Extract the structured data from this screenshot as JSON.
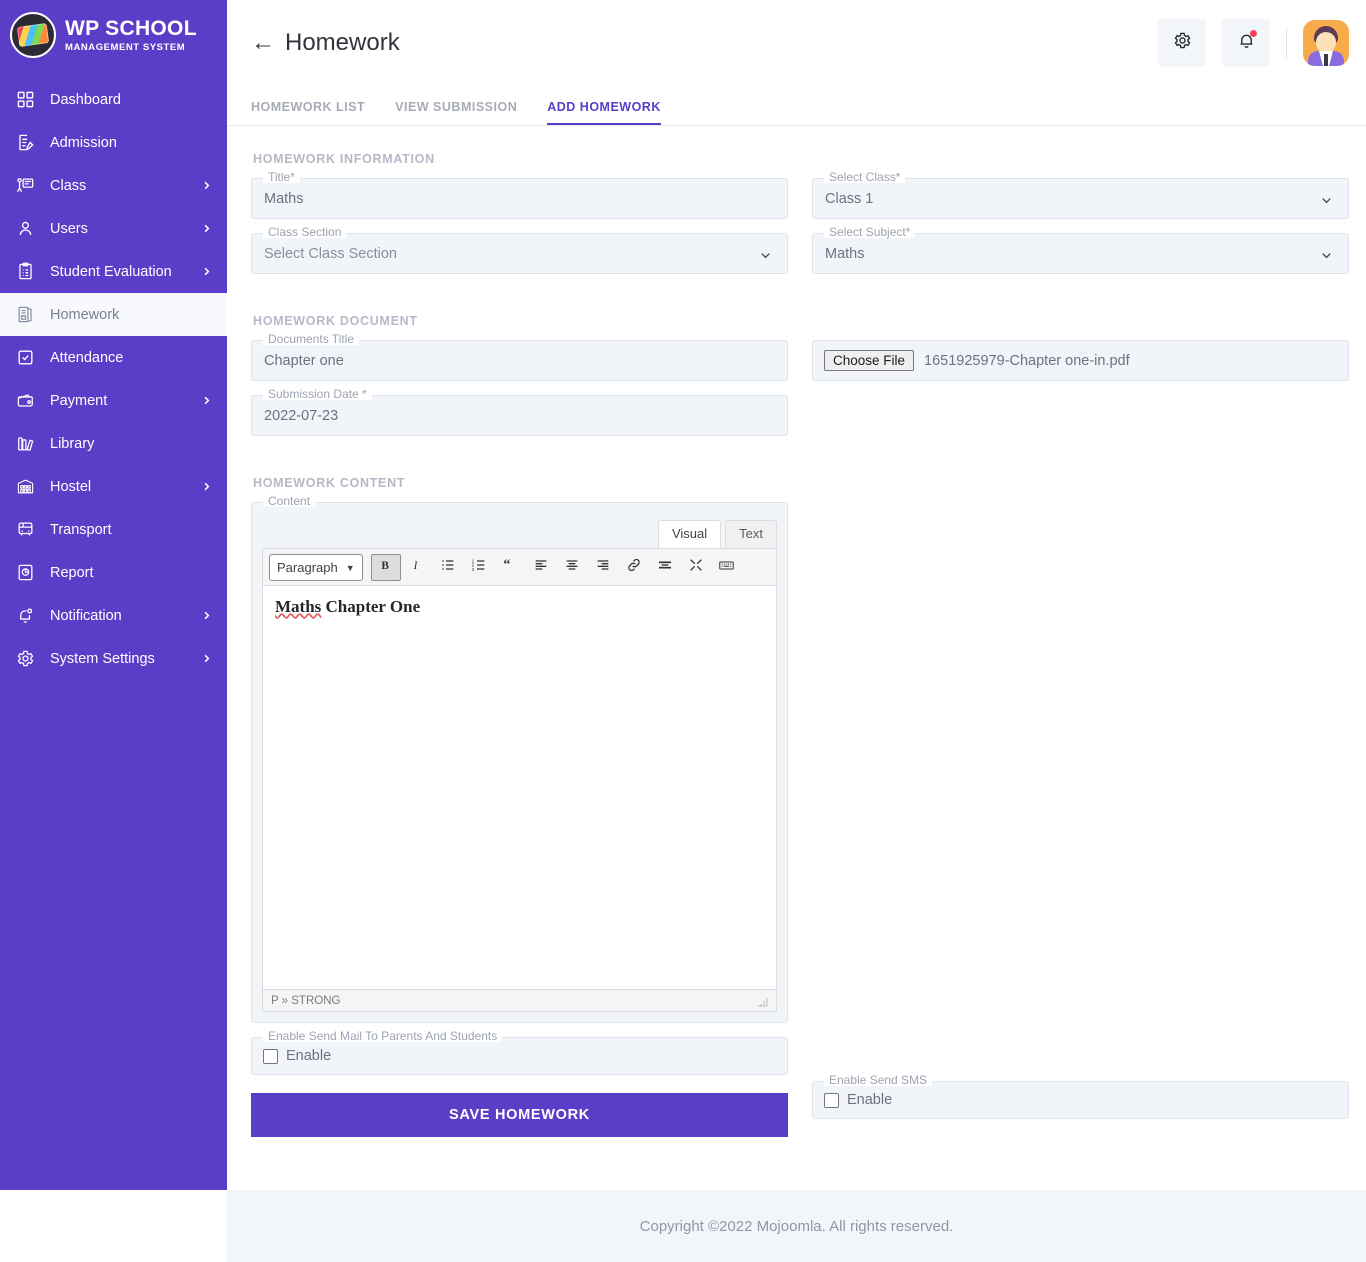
{
  "brand": {
    "title": "WP SCHOOL",
    "subtitle": "MANAGEMENT SYSTEM",
    "logo_icon": "graduation-cap-logo"
  },
  "colors": {
    "sidebar": "#5a3ec8",
    "accent": "#5a3ec8",
    "field_bg": "#f1f4f9",
    "field_border": "#dfe3ec",
    "footer_bg": "#f2f5fa",
    "notification_dot": "#f1435e"
  },
  "sidebar": {
    "items": [
      {
        "label": "Dashboard",
        "icon": "grid-icon",
        "expandable": false,
        "active": false
      },
      {
        "label": "Admission",
        "icon": "document-edit-icon",
        "expandable": false,
        "active": false
      },
      {
        "label": "Class",
        "icon": "teacher-board-icon",
        "expandable": true,
        "active": false
      },
      {
        "label": "Users",
        "icon": "user-icon",
        "expandable": true,
        "active": false
      },
      {
        "label": "Student Evaluation",
        "icon": "clipboard-list-icon",
        "expandable": true,
        "active": false
      },
      {
        "label": "Homework",
        "icon": "book-icon",
        "expandable": false,
        "active": true
      },
      {
        "label": "Attendance",
        "icon": "clipboard-check-icon",
        "expandable": false,
        "active": false
      },
      {
        "label": "Payment",
        "icon": "wallet-icon",
        "expandable": true,
        "active": false
      },
      {
        "label": "Library",
        "icon": "books-icon",
        "expandable": false,
        "active": false
      },
      {
        "label": "Hostel",
        "icon": "building-icon",
        "expandable": true,
        "active": false
      },
      {
        "label": "Transport",
        "icon": "bus-icon",
        "expandable": false,
        "active": false
      },
      {
        "label": "Report",
        "icon": "report-chart-icon",
        "expandable": false,
        "active": false
      },
      {
        "label": "Notification",
        "icon": "bell-pin-icon",
        "expandable": true,
        "active": false
      },
      {
        "label": "System Settings",
        "icon": "gear-icon",
        "expandable": true,
        "active": false
      }
    ]
  },
  "header": {
    "back_icon": "arrow-left-icon",
    "title": "Homework",
    "settings_icon": "gear-icon",
    "notification_icon": "bell-icon",
    "avatar_icon": "user-avatar"
  },
  "tabs": [
    {
      "label": "HOMEWORK LIST",
      "active": false
    },
    {
      "label": "VIEW SUBMISSION",
      "active": false
    },
    {
      "label": "ADD HOMEWORK",
      "active": true
    }
  ],
  "sections": {
    "information_title": "HOMEWORK INFORMATION",
    "document_title": "HOMEWORK DOCUMENT",
    "content_title": "HOMEWORK CONTENT"
  },
  "form": {
    "title": {
      "label": "Title*",
      "value": "Maths"
    },
    "select_class": {
      "label": "Select Class*",
      "value": "Class 1",
      "icon": "chevron-down-icon"
    },
    "class_section": {
      "label": "Class Section",
      "value": "Select Class Section",
      "icon": "chevron-down-icon"
    },
    "select_subject": {
      "label": "Select Subject*",
      "value": "Maths",
      "icon": "chevron-down-icon"
    },
    "documents_title": {
      "label": "Documents Title",
      "value": "Chapter one"
    },
    "submission_date": {
      "label": "Submission Date *",
      "value": "2022-07-23"
    },
    "file_upload": {
      "button_label": "Choose File",
      "file_name": "1651925979-Chapter one-in.pdf"
    },
    "enable_mail": {
      "label": "Enable Send Mail To Parents And Students",
      "checkbox_label": "Enable",
      "checked": false
    },
    "enable_sms": {
      "label": "Enable Send SMS",
      "checkbox_label": "Enable",
      "checked": false
    },
    "save_label": "SAVE HOMEWORK"
  },
  "editor": {
    "legend": "Content",
    "mode_tabs": [
      {
        "label": "Visual",
        "active": true
      },
      {
        "label": "Text",
        "active": false
      }
    ],
    "format_select": "Paragraph",
    "toolbar_icons": [
      "bold-icon",
      "italic-icon",
      "bulleted-list-icon",
      "numbered-list-icon",
      "blockquote-icon",
      "align-left-icon",
      "align-center-icon",
      "align-right-icon",
      "link-icon",
      "read-more-icon",
      "fullscreen-icon",
      "keyboard-shortcuts-icon"
    ],
    "body_text": "Maths Chapter One",
    "body_spellcheck_word": "Maths",
    "body_rest": " Chapter One",
    "status_path": "P » STRONG"
  },
  "footer": {
    "text": "Copyright ©2022 Mojoomla. All rights reserved."
  }
}
